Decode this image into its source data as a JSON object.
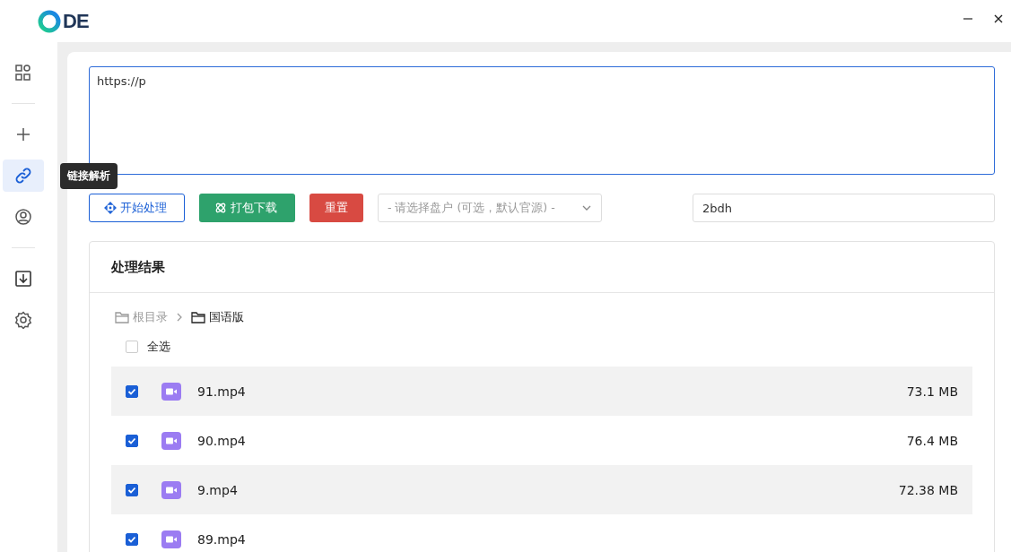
{
  "app": {
    "logo_text": "DE"
  },
  "sidebar": {
    "items": [
      {
        "kind": "grid",
        "selected": false
      },
      {
        "kind": "divider"
      },
      {
        "kind": "plus",
        "selected": false
      },
      {
        "kind": "link",
        "selected": true
      },
      {
        "kind": "user",
        "selected": false
      },
      {
        "kind": "divider"
      },
      {
        "kind": "download",
        "selected": false
      },
      {
        "kind": "gear",
        "selected": false
      }
    ],
    "tooltip": "链接解析"
  },
  "link_input": {
    "value": "https://p"
  },
  "actions": {
    "start": "开始处理",
    "pack": "打包下载",
    "reset": "重置",
    "disk_select": {
      "placeholder": "- 请选择盘户 (可选，默认官源) -"
    },
    "code_input": {
      "value": "2bdh"
    }
  },
  "results": {
    "title": "处理结果",
    "breadcrumb": [
      "根目录",
      "国语版"
    ],
    "select_all": {
      "label": "全选",
      "checked": false
    },
    "files": [
      {
        "name": "91.mp4",
        "size": "73.1 MB",
        "checked": true
      },
      {
        "name": "90.mp4",
        "size": "76.4 MB",
        "checked": true
      },
      {
        "name": "9.mp4",
        "size": "72.38 MB",
        "checked": true
      },
      {
        "name": "89.mp4",
        "checked": true
      }
    ]
  }
}
